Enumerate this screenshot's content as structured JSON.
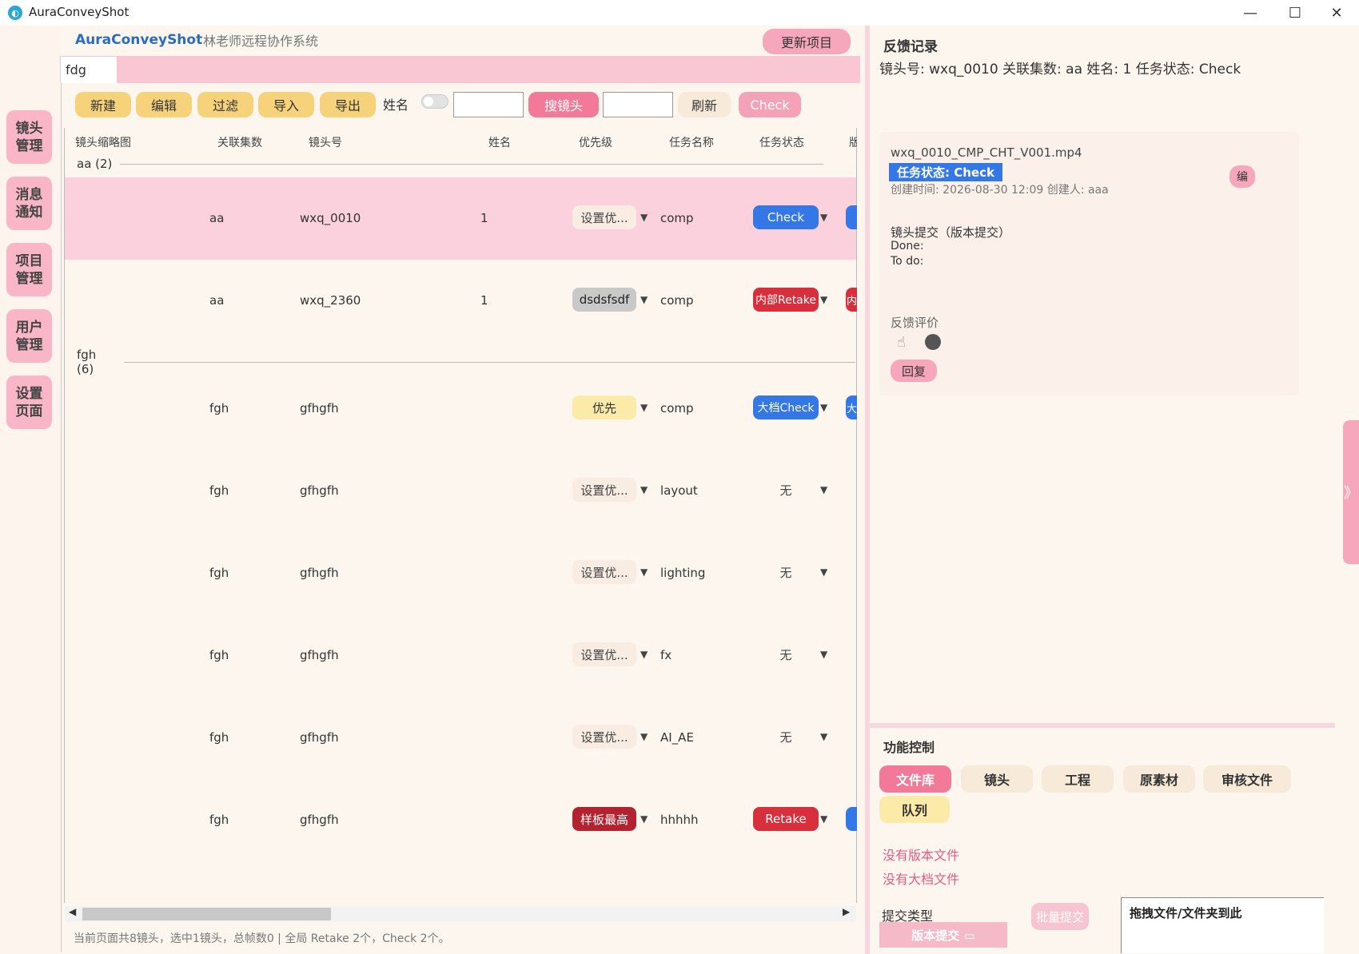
{
  "window": {
    "title": "AuraConveyShot",
    "minimize": "—",
    "maximize": "☐",
    "close": "✕"
  },
  "header": {
    "brand": "AuraConveyShot",
    "subtitle": "林老师远程协作系统",
    "update_button": "更新项目"
  },
  "sidebar": {
    "items": [
      {
        "label": "镜头\n管理"
      },
      {
        "label": "消息\n通知"
      },
      {
        "label": "项目\n管理"
      },
      {
        "label": "用户\n管理"
      },
      {
        "label": "设置\n页面"
      }
    ]
  },
  "tab": {
    "label": "fdg"
  },
  "toolbar": {
    "new": "新建",
    "edit": "编辑",
    "filter": "过滤",
    "import": "导入",
    "export": "导出",
    "name_label": "姓名",
    "search_shot": "搜镜头",
    "refresh": "刷新",
    "check": "Check"
  },
  "table": {
    "headers": [
      "镜头缩略图",
      "关联集数",
      "镜头号",
      "姓名",
      "优先级",
      "任务名称",
      "任务状态",
      "版"
    ],
    "groups": [
      {
        "label": "aa (2)"
      },
      {
        "label": "fgh (6)"
      }
    ],
    "rows": [
      {
        "episode": "aa",
        "shot": "wxq_0010",
        "name": "1",
        "priority": "设置优...",
        "task": "comp",
        "status": "Check"
      },
      {
        "episode": "aa",
        "shot": "wxq_2360",
        "name": "1",
        "priority": "dsdsfsdf",
        "task": "comp",
        "status": "内部Retake"
      },
      {
        "episode": "fgh",
        "shot": "gfhgfh",
        "name": "",
        "priority": "优先",
        "task": "comp",
        "status": "大档Check"
      },
      {
        "episode": "fgh",
        "shot": "gfhgfh",
        "name": "",
        "priority": "设置优...",
        "task": "layout",
        "status": "无"
      },
      {
        "episode": "fgh",
        "shot": "gfhgfh",
        "name": "",
        "priority": "设置优...",
        "task": "lighting",
        "status": "无"
      },
      {
        "episode": "fgh",
        "shot": "gfhgfh",
        "name": "",
        "priority": "设置优...",
        "task": "fx",
        "status": "无"
      },
      {
        "episode": "fgh",
        "shot": "gfhgfh",
        "name": "",
        "priority": "设置优...",
        "task": "AI_AE",
        "status": "无"
      },
      {
        "episode": "fgh",
        "shot": "gfhgfh",
        "name": "",
        "priority": "样板最高",
        "task": "hhhhh",
        "status": "Retake"
      }
    ],
    "edge_labels": [
      "",
      "内",
      "大",
      "",
      "",
      "",
      "",
      ""
    ]
  },
  "statusbar": {
    "text": "当前页面共8镜头，选中1镜头，总帧数0 | 全局 Retake 2个，Check 2个。"
  },
  "feedback": {
    "title": "反馈记录",
    "info": "镜头号: wxq_0010    关联集数: aa    姓名: 1    任务状态: Check",
    "file": "wxq_0010_CMP_CHT_V001.mp4",
    "status_tag": "任务状态: Check",
    "created": "创建时间: 2026-08-30 12:09  创建人: aaa",
    "edit": "编",
    "submission": "镜头提交（版本提交）",
    "done": "Done:",
    "todo": "To do:",
    "eval_label": "反馈评价",
    "reply": "回复"
  },
  "function_control": {
    "title": "功能控制",
    "tabs": [
      "文件库",
      "镜头",
      "工程",
      "原素材",
      "审核文件",
      "队列"
    ],
    "no_version": "没有版本文件",
    "no_archive": "没有大档文件",
    "submit_type_label": "提交类型",
    "submit_type_value": "版本提交 ▭",
    "batch_submit": "批量提交",
    "dropzone": "拖拽文件/文件夹到此"
  },
  "collapse": {
    "label": "》"
  },
  "colors": {
    "accent_pink": "#f6a7bb",
    "accent_yellow": "#f6d27b",
    "status_blue": "#3478e8",
    "status_red": "#d7303c",
    "brand_blue": "#2a6cc0"
  }
}
